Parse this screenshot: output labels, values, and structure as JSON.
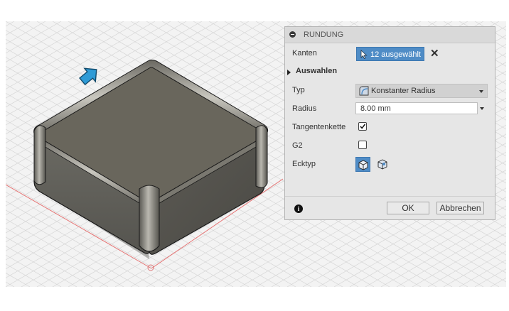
{
  "dialog": {
    "title": "RUNDUNG",
    "edges": {
      "label": "Kanten",
      "selection": "12 ausgewählt"
    },
    "section": {
      "label": "Auswahlen"
    },
    "type": {
      "label": "Typ",
      "value": "Konstanter Radius"
    },
    "radius": {
      "label": "Radius",
      "value": "8.00 mm"
    },
    "tangent_chain": {
      "label": "Tangentenkette",
      "checked": true
    },
    "g2": {
      "label": "G2",
      "checked": false
    },
    "corner_type": {
      "label": "Ecktyp"
    },
    "ok_label": "OK",
    "cancel_label": "Abbrechen"
  },
  "colors": {
    "accent": "#4f8cc6",
    "panel_bg": "#e6e6e6",
    "viewport_bg": "#f3f3f3",
    "axis_red": "#e67373",
    "arrow_blue": "#2f9bd6"
  }
}
